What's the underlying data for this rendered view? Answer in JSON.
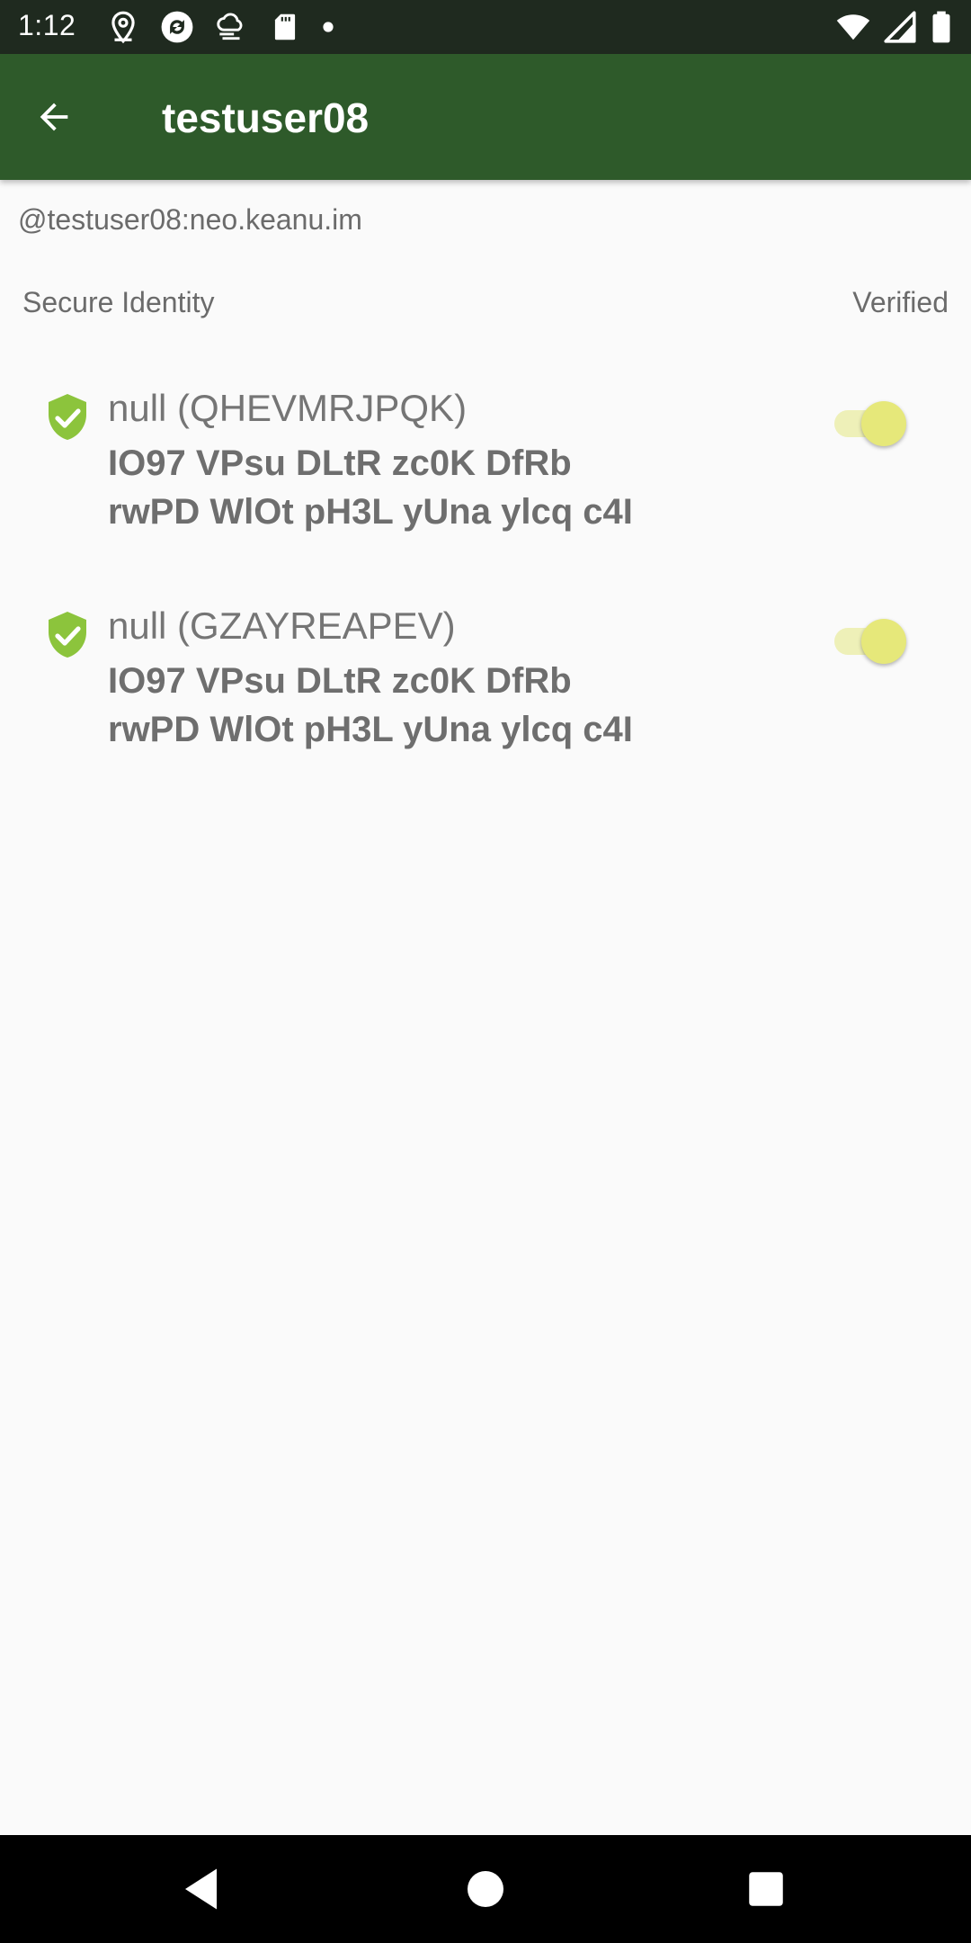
{
  "status_bar": {
    "time": "1:12",
    "left_icons": [
      "location-icon",
      "sync-icon",
      "weather-icon",
      "sd-card-icon",
      "notification-dot-icon"
    ],
    "right_icons": [
      "wifi-icon",
      "signal-icon",
      "battery-icon"
    ]
  },
  "app_bar": {
    "title": "testuser08",
    "back_icon": "arrow-back-icon"
  },
  "user_id": "@testuser08:neo.keanu.im",
  "section": {
    "title": "Secure Identity",
    "verified_label": "Verified"
  },
  "devices": [
    {
      "name": "null (QHEVMRJPQK)",
      "key_line1": "IO97 VPsu DLtR zc0K DfRb",
      "key_line2": "rwPD WlOt pH3L yUna ylcq c4I",
      "verified": true,
      "icon": "verified-shield-icon"
    },
    {
      "name": "null (GZAYREAPEV)",
      "key_line1": "IO97 VPsu DLtR zc0K DfRb",
      "key_line2": "rwPD WlOt pH3L yUna ylcq c4I",
      "verified": true,
      "icon": "verified-shield-icon"
    }
  ],
  "nav_bar": {
    "buttons": [
      "back-triangle-icon",
      "home-circle-icon",
      "recents-square-icon"
    ]
  },
  "colors": {
    "status_bar": "#1f2a1f",
    "app_bar": "#2e5a2a",
    "shield": "#8cc43c",
    "toggle_thumb": "#e6e87a",
    "toggle_track": "#eef0b8"
  }
}
